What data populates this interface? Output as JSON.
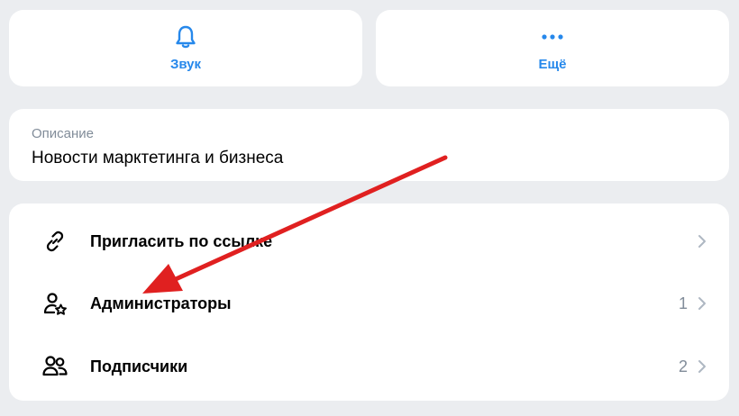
{
  "actions": {
    "sound_label": "Звук",
    "more_label": "Ещё"
  },
  "description": {
    "label": "Описание",
    "value": "Новости марктетинга и бизнеса"
  },
  "menu": {
    "items": [
      {
        "label": "Пригласить по ссылке",
        "count": ""
      },
      {
        "label": "Администраторы",
        "count": "1"
      },
      {
        "label": "Подписчики",
        "count": "2"
      }
    ]
  },
  "colors": {
    "accent": "#2688eb",
    "background": "#ebedf0",
    "secondary_text": "#818c99",
    "annotation_arrow": "#e02020"
  },
  "icons": [
    "bell-icon",
    "more-dots-icon",
    "link-icon",
    "user-star-icon",
    "users-icon",
    "chevron-right-icon"
  ]
}
